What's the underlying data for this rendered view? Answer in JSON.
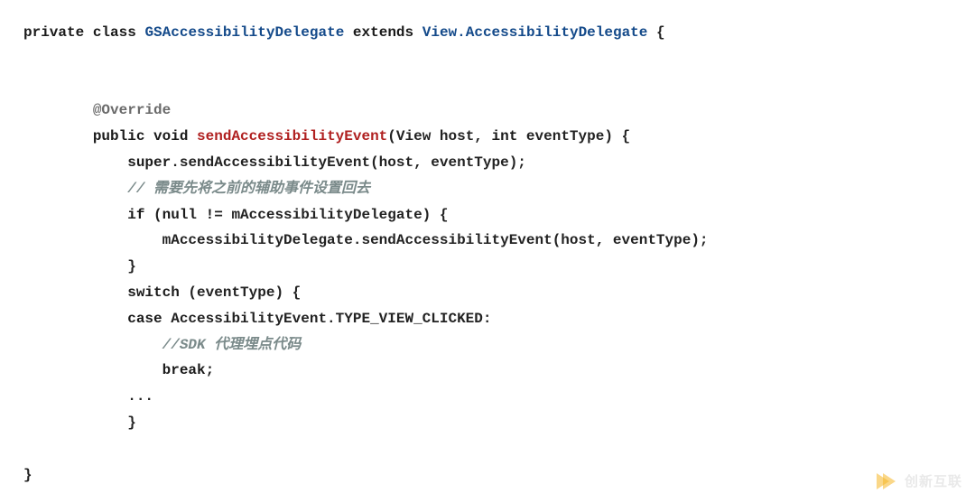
{
  "code": {
    "line1": {
      "kw_private": "private",
      "kw_class": "class",
      "cls1": "GSAccessibilityDelegate",
      "kw_extends": "extends",
      "cls2": "View.AccessibilityDelegate",
      "brace": "{"
    },
    "line2": "",
    "line3": "",
    "line4": {
      "anno": "@Override"
    },
    "line5": {
      "kw_public": "public",
      "kw_void": "void",
      "method": "sendAccessibilityEvent",
      "sig_a": "(View host, ",
      "kw_int": "int",
      "sig_b": " eventType) {"
    },
    "line6": {
      "kw_super": "super",
      "rest": ".sendAccessibilityEvent(host, eventType);"
    },
    "line7": {
      "cmt": "// 需要先将之前的辅助事件设置回去"
    },
    "line8": {
      "kw_if": "if",
      "cond_a": " (",
      "kw_null": "null",
      "cond_b": " != mAccessibilityDelegate) {"
    },
    "line9": {
      "stmt": "mAccessibilityDelegate.sendAccessibilityEvent(host, eventType);"
    },
    "line10": {
      "brace": "}"
    },
    "line11": {
      "kw_switch": "switch",
      "rest": " (eventType) {"
    },
    "line12": {
      "kw_case": "case",
      "rest": " AccessibilityEvent.TYPE_VIEW_CLICKED:"
    },
    "line13": {
      "cmt": "//SDK 代理埋点代码"
    },
    "line14": {
      "kw_break": "break",
      "semi": ";"
    },
    "line15": {
      "ellipsis": "..."
    },
    "line16": {
      "brace": "}"
    },
    "line17": "",
    "line18": {
      "brace": "}"
    }
  },
  "indent": {
    "i0": "",
    "i2": "        ",
    "i3": "            ",
    "i4": "                ",
    "i5": "                    "
  },
  "watermark": {
    "text": "创新互联"
  }
}
